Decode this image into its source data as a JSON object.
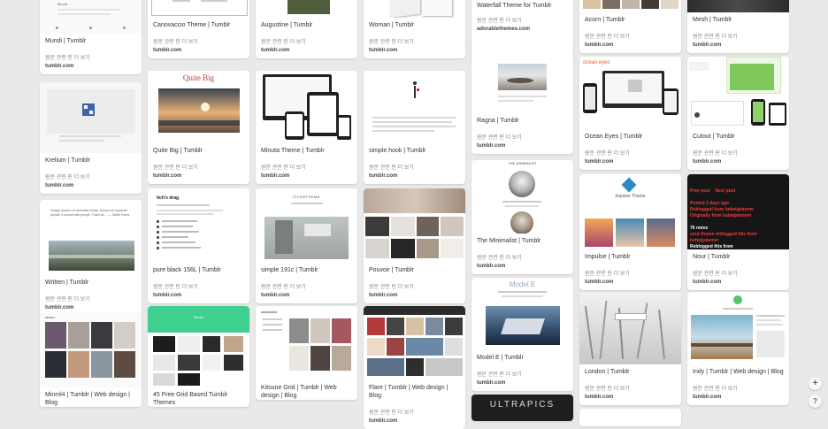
{
  "columns": [
    {
      "pins": [
        {
          "title": "Mundi | Tumblr",
          "more": "원문 관련 핀 더 보기",
          "domain": "tumblr.com",
          "thumb_text": "Mundi"
        },
        {
          "title": "Krelium | Tumblr",
          "more": "원문 관련 핀 더 보기",
          "domain": "tumblr.com"
        },
        {
          "title": "Written | Tumblr",
          "more": "원문 관련 핀 더 보기",
          "domain": "tumblr.com",
          "thumb_text": "Design should not dominate things, should not dominate people. It should help people. That's its ... — Dieter Rams"
        },
        {
          "title": "Minml4 | Tumblr | Web design | Blog",
          "more": "",
          "domain": "",
          "thumb_text": "MINML4"
        }
      ]
    },
    {
      "pins": [
        {
          "title": "Canovaccio Theme | Tumblr",
          "more": "원문 관련 핀 더 보기",
          "domain": "tumblr.com"
        },
        {
          "title": "Quite Big | Tumblr",
          "more": "원문 관련 핀 더 보기",
          "domain": "tumblr.com",
          "thumb_text": "Quite Big"
        },
        {
          "title": "pure black 156L | Tumblr",
          "more": "원문 관련 핀 더 보기",
          "domain": "tumblr.com",
          "thumb_text": "itch's drag"
        },
        {
          "title": "45 Free Grid Based Tumblr Themes",
          "more": "",
          "domain": "",
          "thumb_text": "Boxes"
        }
      ]
    },
    {
      "pins": [
        {
          "title": "Augustine | Tumblr",
          "more": "원문 관련 핀 더 보기",
          "domain": "tumblr.com"
        },
        {
          "title": "Minuta Theme | Tumblr",
          "more": "원문 관련 핀 더 보기",
          "domain": "tumblr.com"
        },
        {
          "title": "simple 191c | Tumblr",
          "more": "원문 관련 핀 더 보기",
          "domain": "tumblr.com",
          "thumb_text": "ITCHSTHEME"
        },
        {
          "title": "Kitsune Grid | Tumblr | Web design | Blog",
          "more": "",
          "domain": ""
        }
      ]
    },
    {
      "pins": [
        {
          "title": "Woman | Tumblr",
          "more": "원문 관련 핀 더 보기",
          "domain": "tumblr.com"
        },
        {
          "title": "simple hook | Tumblr",
          "more": "원문 관련 핀 더 보기",
          "domain": "tumblr.com"
        },
        {
          "title": "Pouvoir | Tumblr",
          "more": "원문 관련 핀 더 보기",
          "domain": "tumblr.com"
        },
        {
          "title": "Flare | Tumblr | Web design | Blog",
          "more": "원문 관련 핀 더 보기",
          "domain": "tumblr.com"
        }
      ]
    },
    {
      "pins": [
        {
          "title": "Waterfall Theme for Tumblr",
          "more": "원문 관련 핀 더 보기",
          "domain": "adorablethemes.com"
        },
        {
          "title": "Ragna | Tumblr",
          "more": "원문 관련 핀 더 보기",
          "domain": "tumblr.com"
        },
        {
          "title": "The Minimalist | Tumblr",
          "more": "원문 관련 핀 더 보기",
          "domain": "tumblr.com",
          "thumb_text": "THE MINIMALIST"
        },
        {
          "title": "Model E | Tumblr",
          "more": "원문 관련 핀 더 보기",
          "domain": "tumblr.com",
          "thumb_text": "Model E"
        },
        {
          "title": "",
          "more": "",
          "domain": "",
          "thumb_text": "ULTRAPICS"
        }
      ]
    },
    {
      "pins": [
        {
          "title": "Acorn | Tumblr",
          "more": "원문 관련 핀 더 보기",
          "domain": "tumblr.com"
        },
        {
          "title": "Ocean Eyes | Tumblr",
          "more": "원문 관련 핀 더 보기",
          "domain": "tumblr.com",
          "thumb_text": "ocean eyes"
        },
        {
          "title": "Impulse | Tumblr",
          "more": "원문 관련 핀 더 보기",
          "domain": "tumblr.com",
          "thumb_text": "Impulse Theme"
        },
        {
          "title": "London | Tumblr",
          "more": "원문 관련 핀 더 보기",
          "domain": "tumblr.com"
        }
      ]
    },
    {
      "pins": [
        {
          "title": "Mesh | Tumblr",
          "more": "원문 관련 핀 더 보기",
          "domain": "tumblr.com"
        },
        {
          "title": "Cutout | Tumblr",
          "more": "원문 관련 핀 더 보기",
          "domain": "tumblr.com"
        },
        {
          "title": "Nour | Tumblr",
          "more": "원문 관련 핀 더 보기",
          "domain": "tumblr.com",
          "nour_lines": [
            "Prev post    Next post",
            "Posted 3 days ago",
            "Reblogged from ludwigdanner",
            "Originally from ludwigdanner",
            "76 notes",
            "sour-theme reblogged this from",
            "ludwigdanner",
            "Reblogged this from"
          ]
        },
        {
          "title": "Indy | Tumblr | Web design | Blog",
          "more": "원문 관련 핀 더 보기",
          "domain": "tumblr.com"
        }
      ]
    }
  ],
  "side_buttons": {
    "add": "+",
    "help": "?"
  }
}
